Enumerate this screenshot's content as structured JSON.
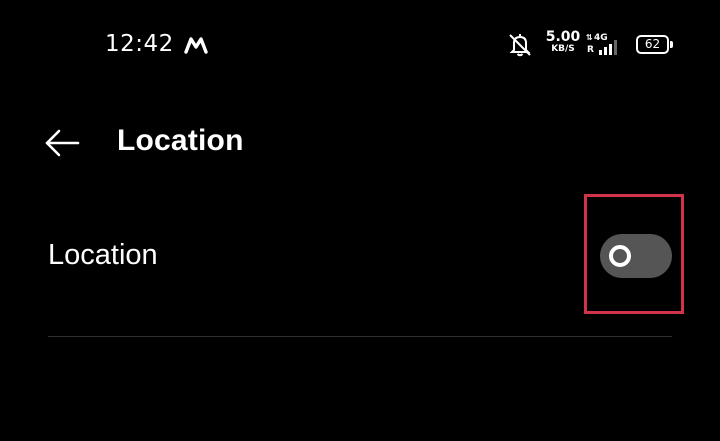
{
  "status_bar": {
    "time": "12:42",
    "app_icon": "m-logo-icon",
    "bell_icon": "bell-off-icon",
    "speed_value": "5.00",
    "speed_unit": "KB/S",
    "network_type": "4G",
    "roaming": "R",
    "signal_icon": "signal-bars-icon",
    "battery_level": "62"
  },
  "header": {
    "back_icon": "arrow-left-icon",
    "title": "Location"
  },
  "settings": {
    "location_row": {
      "label": "Location",
      "toggle_state": "off",
      "toggle_track_color": "#555555",
      "highlight_color": "#d0334a"
    }
  }
}
